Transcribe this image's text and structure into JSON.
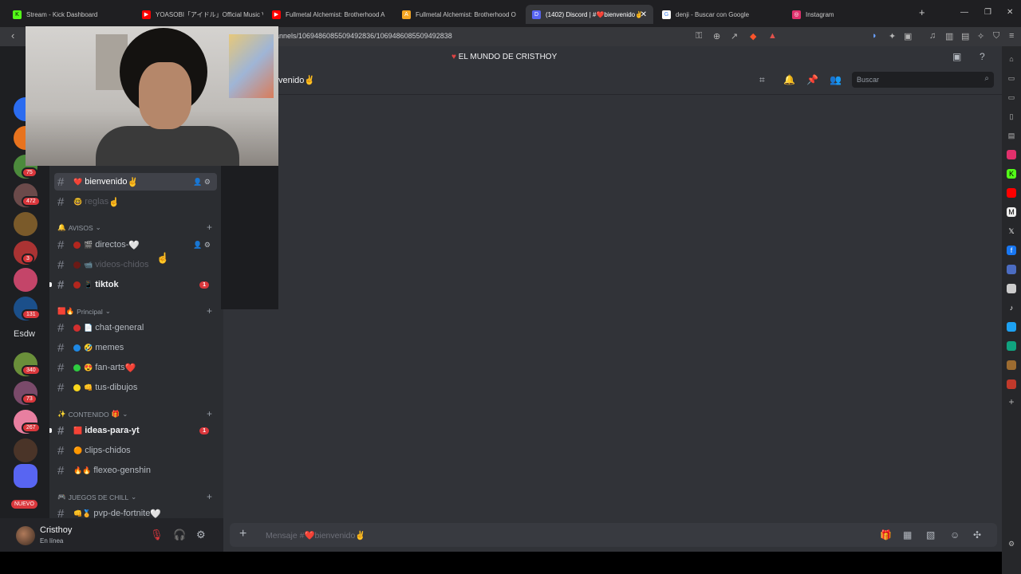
{
  "browser": {
    "tabs": [
      {
        "title": "Stream - Kick Dashboard",
        "color": "#53fc18",
        "glyph": "K"
      },
      {
        "title": "YOASOBI「アイドル」Official Music Vid",
        "color": "#ff0000",
        "glyph": "▶"
      },
      {
        "title": "Fullmetal Alchemist: Brotherhood A",
        "color": "#ff0000",
        "glyph": "▶"
      },
      {
        "title": "Fullmetal Alchemist: Brotherhood O",
        "color": "#f5a623",
        "glyph": "A"
      },
      {
        "title": "(1402) Discord | #❤️bienvenido✌",
        "color": "#5865f2",
        "glyph": "D"
      },
      {
        "title": "denji - Buscar con Google",
        "color": "#4285f4",
        "glyph": "G"
      },
      {
        "title": "Instagram",
        "color": "#e1306c",
        "glyph": "◎"
      }
    ],
    "url": "annels/1069486085509492836/1069486085509492838"
  },
  "server": {
    "name": "EL MUNDO DE CRISTHOY",
    "sidebar_text": "Esdw",
    "new_label": "NUEVO",
    "badges": [
      "75",
      "472",
      "3",
      "131",
      "340",
      "73",
      "267"
    ]
  },
  "channels": {
    "categories": [
      {
        "name": "AVISOS",
        "emoji": "🔔"
      },
      {
        "name": "Principal",
        "emoji": "🟥🔥"
      },
      {
        "name": "CONTENIDO",
        "emoji": "✨"
      },
      {
        "name": "JUEGOS DE CHILL",
        "emoji": "🎮"
      }
    ],
    "items": [
      {
        "name": "bienvenido",
        "prefix": "❤️",
        "suffix": "✌"
      },
      {
        "name": "reglas",
        "prefix": "🤓",
        "suffix": "☝"
      },
      {
        "name": "directos-",
        "prefix": "🎬",
        "suffix": "🤍"
      },
      {
        "name": "videos-chidos",
        "prefix": "📹",
        "suffix": ""
      },
      {
        "name": "tiktok",
        "prefix": "📱",
        "suffix": "",
        "badge": "1"
      },
      {
        "name": "chat-general",
        "prefix": "📄",
        "suffix": ""
      },
      {
        "name": "memes",
        "prefix": "🤣",
        "suffix": ""
      },
      {
        "name": "fan-arts",
        "prefix": "😍",
        "suffix": "❤️"
      },
      {
        "name": "tus-dibujos",
        "prefix": "👊",
        "suffix": ""
      },
      {
        "name": "ideas-para-yt",
        "prefix": "🟥",
        "suffix": "",
        "badge": "1"
      },
      {
        "name": "clips-chidos",
        "prefix": "🟠",
        "suffix": ""
      },
      {
        "name": "flexeo-genshin",
        "prefix": "🔥🔥",
        "suffix": ""
      },
      {
        "name": "pvp-de-fortnite",
        "prefix": "👊🏅",
        "suffix": "🤍"
      }
    ]
  },
  "user": {
    "name": "Cristhoy",
    "status": "En línea"
  },
  "main": {
    "channel_title": "venido✌",
    "search_placeholder": "Buscar",
    "composer_placeholder": "Mensaje #❤️bienvenido✌"
  },
  "colors": {
    "accent": "#5865f2",
    "red": "#da373c",
    "bg": "#313338"
  }
}
